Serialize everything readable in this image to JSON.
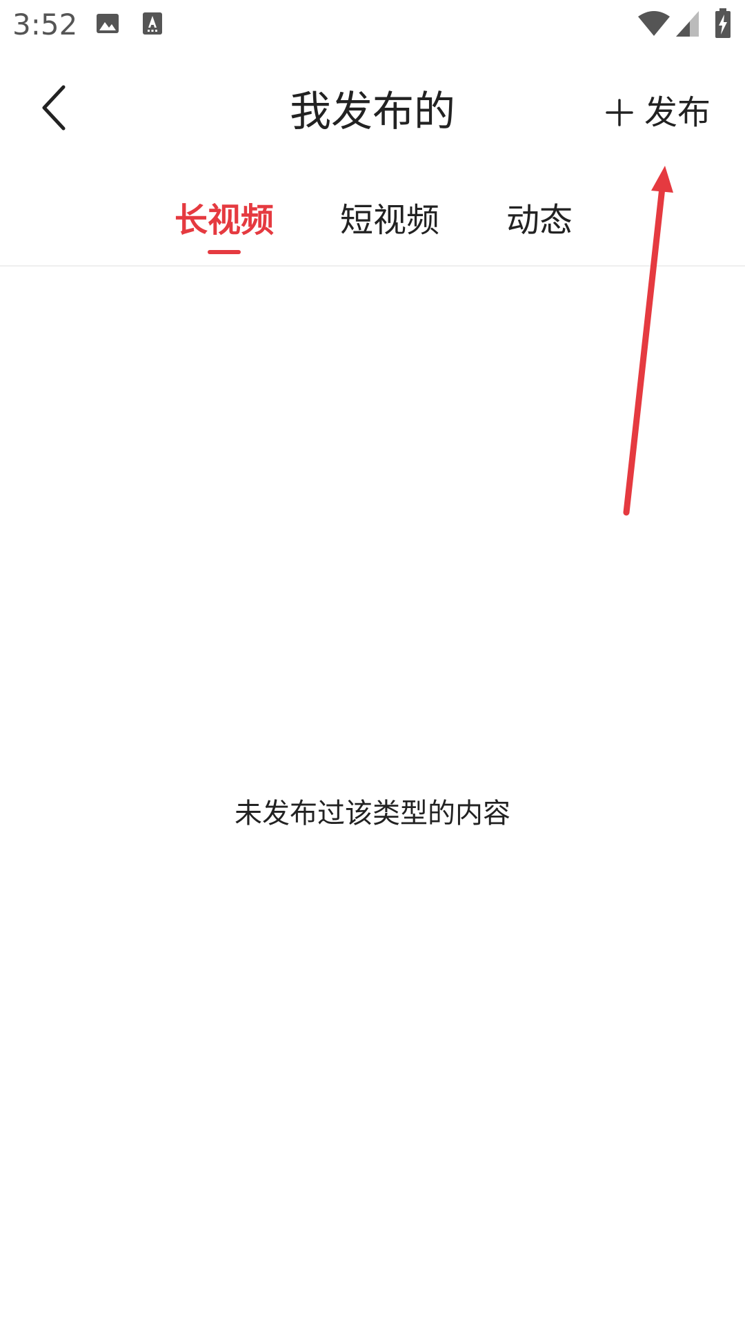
{
  "status_bar": {
    "time": "3:52",
    "icons": [
      "image-icon",
      "text-input-icon",
      "wifi-icon",
      "signal-icon",
      "battery-charging-icon"
    ]
  },
  "header": {
    "title": "我发布的",
    "back_icon": "chevron-left-icon",
    "publish_label": "发布",
    "publish_icon": "plus-icon"
  },
  "tabs": [
    {
      "label": "长视频",
      "active": true
    },
    {
      "label": "短视频",
      "active": false
    },
    {
      "label": "动态",
      "active": false
    }
  ],
  "empty_state": {
    "message": "未发布过该类型的内容"
  },
  "colors": {
    "accent": "#e53a40",
    "text": "#222222",
    "status_text": "#555555",
    "annotation": "#e53a40"
  }
}
